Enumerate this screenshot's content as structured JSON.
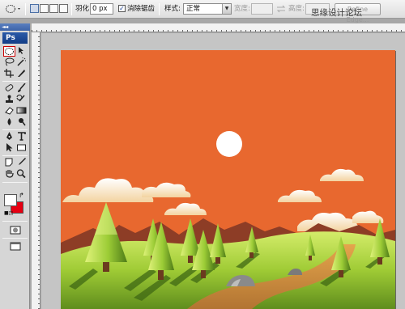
{
  "options_bar": {
    "tool_icon": "elliptical-marquee-icon",
    "feather_label": "羽化:",
    "feather_value": "0 px",
    "antialias_label": "消除锯齿",
    "antialias_checked": true,
    "style_label": "样式:",
    "style_value": "正常",
    "width_label": "宽度:",
    "height_label": "高度:",
    "refine_edge_label": "Refine Edge..."
  },
  "toolbox": {
    "logo": "Ps",
    "collapse_arrows": "◄◄",
    "tools": [
      "elliptical-marquee-icon",
      "move-icon",
      "lasso-icon",
      "magic-wand-icon",
      "crop-icon",
      "slice-icon",
      "healing-brush-icon",
      "brush-icon",
      "clone-stamp-icon",
      "history-brush-icon",
      "eraser-icon",
      "gradient-icon",
      "blur-icon",
      "dodge-icon",
      "pen-icon",
      "type-icon",
      "path-selection-icon",
      "shape-icon",
      "notes-icon",
      "eyedropper-icon",
      "hand-icon",
      "zoom-icon"
    ],
    "foreground_color": "#ffffff",
    "background_color": "#e60012",
    "quick_mask_icon": "quick-mask-icon",
    "screen_mode_icon": "screen-mode-icon"
  },
  "watermark": "思缘设计论坛",
  "colors": {
    "sky": "#e8682f",
    "sun": "#ffffff",
    "hills": "#8d3d26",
    "grass_light": "#c6e25a",
    "grass_dark": "#5d8a1c",
    "path": "#c98a3c"
  }
}
